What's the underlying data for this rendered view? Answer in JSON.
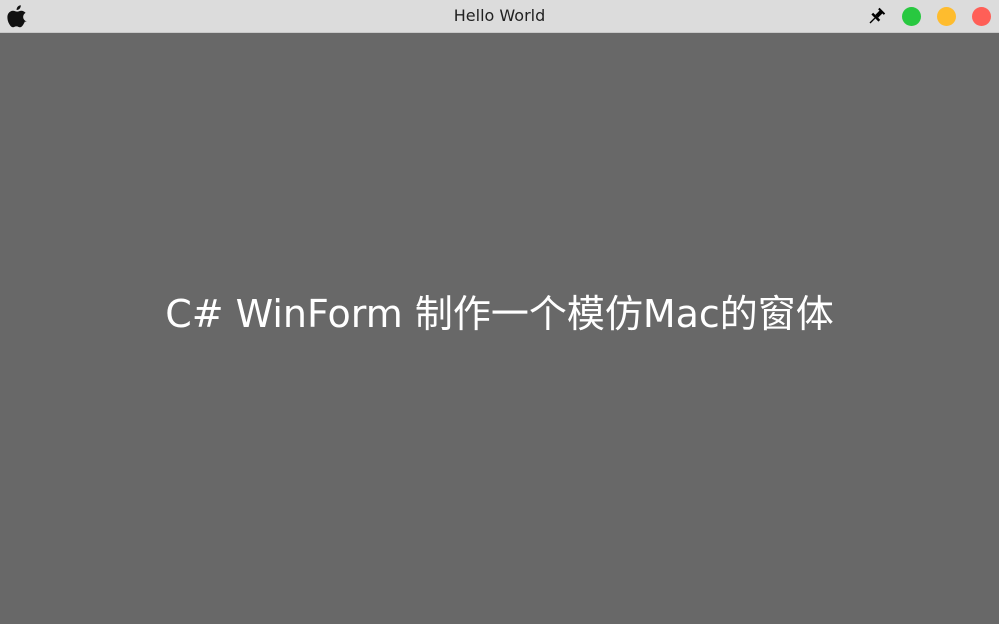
{
  "window": {
    "title": "Hello World",
    "background_color": "#686868",
    "titlebar_color": "#dcdcdc"
  },
  "titlebar": {
    "left_icon": "apple-icon",
    "pin_icon": "pin-icon",
    "buttons": [
      {
        "name": "maximize",
        "color": "#28c840"
      },
      {
        "name": "minimize",
        "color": "#febc2e"
      },
      {
        "name": "close",
        "color": "#ff5f57"
      }
    ]
  },
  "main": {
    "text": "C# WinForm 制作一个模仿Mac的窗体",
    "text_color": "#ffffff"
  }
}
